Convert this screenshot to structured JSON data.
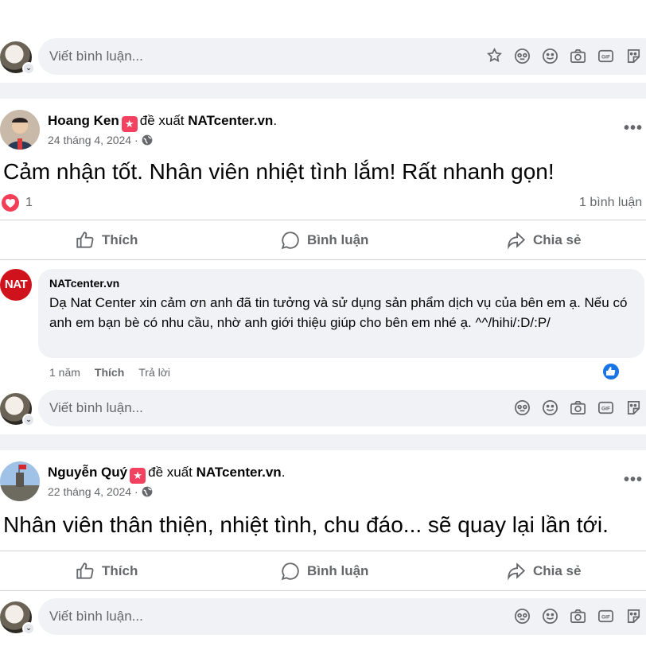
{
  "composer": {
    "placeholder": "Viết bình luận..."
  },
  "posts": [
    {
      "author": "Hoang Ken",
      "verb": "đề xuất",
      "page": "NATcenter.vn",
      "date": "24 tháng 4, 2024",
      "separator": "·",
      "text": "Cảm nhận tốt. Nhân viên nhiệt tình lắm! Rất nhanh gọn!",
      "reaction_count": "1",
      "comment_count": "1 bình luận"
    },
    {
      "author": "Nguyễn Quý",
      "verb": "đề xuất",
      "page": "NATcenter.vn",
      "date": "22 tháng 4, 2024",
      "separator": "·",
      "text": "Nhân viên thân thiện, nhiệt tình, chu đáo... sẽ quay lại lần tới."
    }
  ],
  "actions": {
    "like": "Thích",
    "comment": "Bình luận",
    "share": "Chia sẻ"
  },
  "reply": {
    "avatar_text": "NAT",
    "name": "NATcenter.vn",
    "text": "Dạ Nat Center xin cảm ơn anh đã tin tưởng và sử dụng sản phẩm dịch vụ của bên em ạ. Nếu có anh em bạn bè có nhu cầu, nhờ anh giới thiệu giúp cho bên em nhé ạ. ^^/hihi/:D/:P/",
    "time": "1 năm",
    "like": "Thích",
    "reply": "Trả lời"
  },
  "colors": {
    "accent": "#1b74e4",
    "heart": "#f33e58",
    "badge": "#f3425f",
    "nat_red": "#d0121c"
  },
  "icons": [
    "sticker-icon",
    "avatar-sticker-icon",
    "emoji-icon",
    "camera-icon",
    "gif-icon",
    "sticker-face-icon",
    "like-icon",
    "comment-icon",
    "share-icon",
    "globe-icon",
    "more-icon"
  ]
}
